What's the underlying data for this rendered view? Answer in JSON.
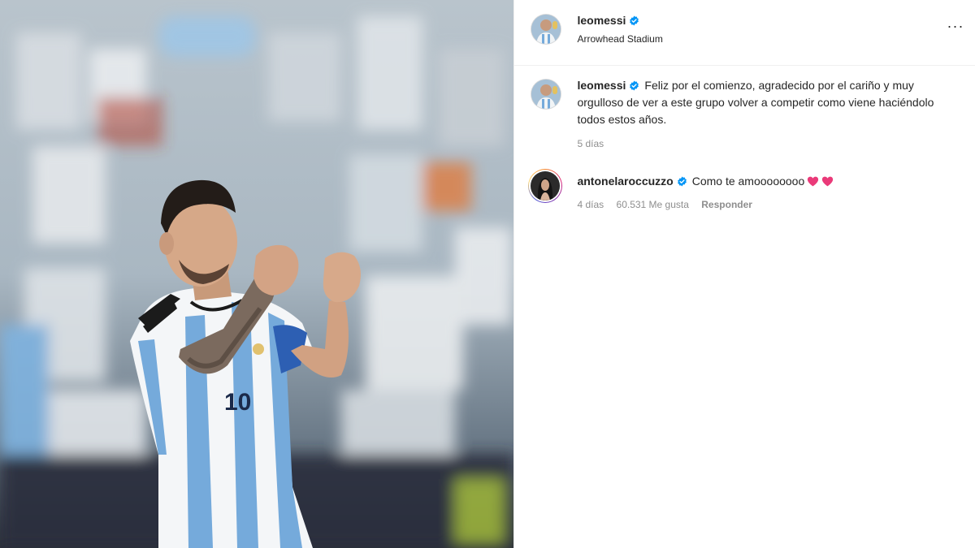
{
  "post": {
    "author": {
      "username": "leomessi",
      "verified": true
    },
    "location": "Arrowhead Stadium",
    "menu_icon": "more-horizontal-icon",
    "caption": {
      "username": "leomessi",
      "text": "Feliz por el comienzo, agradecido por el cariño y muy orgulloso de ver a este grupo volver a competir como viene haciéndolo todos estos años.",
      "time": "5 días"
    },
    "comments": [
      {
        "username": "antonelaroccuzzo",
        "verified": true,
        "text": "Como te amoooooooo",
        "emoji": [
          "heart-icon",
          "heart-icon"
        ],
        "time": "4 días",
        "likes": "60.531 Me gusta",
        "reply_label": "Responder"
      }
    ]
  },
  "colors": {
    "verified_blue": "#0095f6",
    "heart_pink": "#ea3a79",
    "jersey_blue": "#75aadb",
    "muted_text": "#8e8e8e"
  },
  "media": {
    "description_icon": "photo-player-celebrating",
    "jersey_number": "10"
  }
}
